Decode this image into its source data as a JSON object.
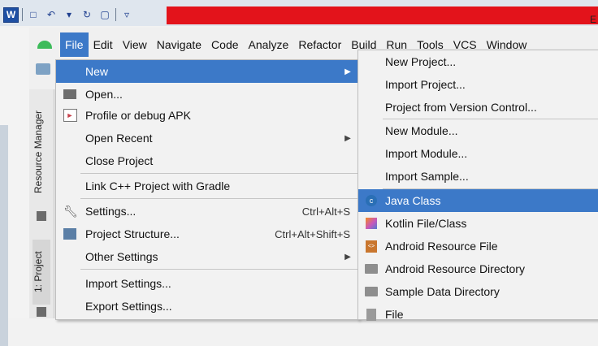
{
  "word": {
    "logo": "W",
    "qat": [
      "save",
      "undo",
      "redo",
      "new-document",
      "customize"
    ]
  },
  "menubar": {
    "items": [
      "File",
      "Edit",
      "View",
      "Navigate",
      "Code",
      "Analyze",
      "Refactor",
      "Build",
      "Run",
      "Tools",
      "VCS",
      "Window"
    ],
    "active": "File"
  },
  "side_tabs": {
    "resource_manager": "Resource Manager",
    "project": "1: Project"
  },
  "file_menu": {
    "items": [
      {
        "label": "New",
        "icon": "",
        "shortcut": "",
        "submenu": true,
        "selected": true
      },
      {
        "label": "Open...",
        "icon": "folder-open-icon",
        "shortcut": "",
        "submenu": false
      },
      {
        "label": "Profile or debug APK",
        "icon": "apk-icon",
        "shortcut": "",
        "submenu": false
      },
      {
        "label": "Open Recent",
        "icon": "",
        "shortcut": "",
        "submenu": true
      },
      {
        "label": "Close Project",
        "icon": "",
        "shortcut": "",
        "submenu": false
      },
      {
        "label": "Link C++ Project with Gradle",
        "icon": "",
        "shortcut": "",
        "submenu": false
      },
      {
        "label": "Settings...",
        "icon": "wrench-icon",
        "shortcut": "Ctrl+Alt+S",
        "submenu": false
      },
      {
        "label": "Project Structure...",
        "icon": "project-structure-icon",
        "shortcut": "Ctrl+Alt+Shift+S",
        "submenu": false
      },
      {
        "label": "Other Settings",
        "icon": "",
        "shortcut": "",
        "submenu": true
      },
      {
        "label": "Import Settings...",
        "icon": "",
        "shortcut": "",
        "submenu": false
      },
      {
        "label": "Export Settings...",
        "icon": "",
        "shortcut": "",
        "submenu": false
      }
    ]
  },
  "new_submenu": {
    "items": [
      {
        "label": "New Project...",
        "icon": ""
      },
      {
        "label": "Import Project...",
        "icon": ""
      },
      {
        "label": "Project from Version Control...",
        "icon": ""
      },
      {
        "label": "New Module...",
        "icon": ""
      },
      {
        "label": "Import Module...",
        "icon": ""
      },
      {
        "label": "Import Sample...",
        "icon": ""
      },
      {
        "label": "Java Class",
        "icon": "java-class-icon",
        "selected": true
      },
      {
        "label": "Kotlin File/Class",
        "icon": "kotlin-icon"
      },
      {
        "label": "Android Resource File",
        "icon": "xml-resource-icon"
      },
      {
        "label": "Android Resource Directory",
        "icon": "folder-icon"
      },
      {
        "label": "Sample Data Directory",
        "icon": "folder-icon"
      },
      {
        "label": "File",
        "icon": "file-icon"
      }
    ]
  },
  "colors": {
    "selection": "#3c79c8",
    "word_red": "#e3131b"
  }
}
